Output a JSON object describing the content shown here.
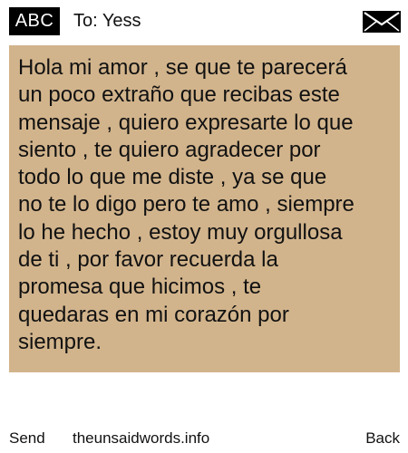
{
  "header": {
    "input_mode": "ABC",
    "recipient": "To: Yess",
    "message_icon": "envelope-icon"
  },
  "message": {
    "body": "Hola mi amor , se que te parecerá\nun poco extraño que recibas este\nmensaje , quiero expresarte lo que\nsiento , te quiero agradecer por\ntodo lo que me diste , ya se que\nno te lo digo pero te amo , siempre\nlo he hecho , estoy muy orgullosa\nde ti , por favor recuerda la\npromesa que hicimos , te\nquedaras en mi corazón por\nsiempre.",
    "background_color": "#d2b48c"
  },
  "footer": {
    "send_label": "Send",
    "site_label": "theunsaidwords.info",
    "back_label": "Back"
  }
}
